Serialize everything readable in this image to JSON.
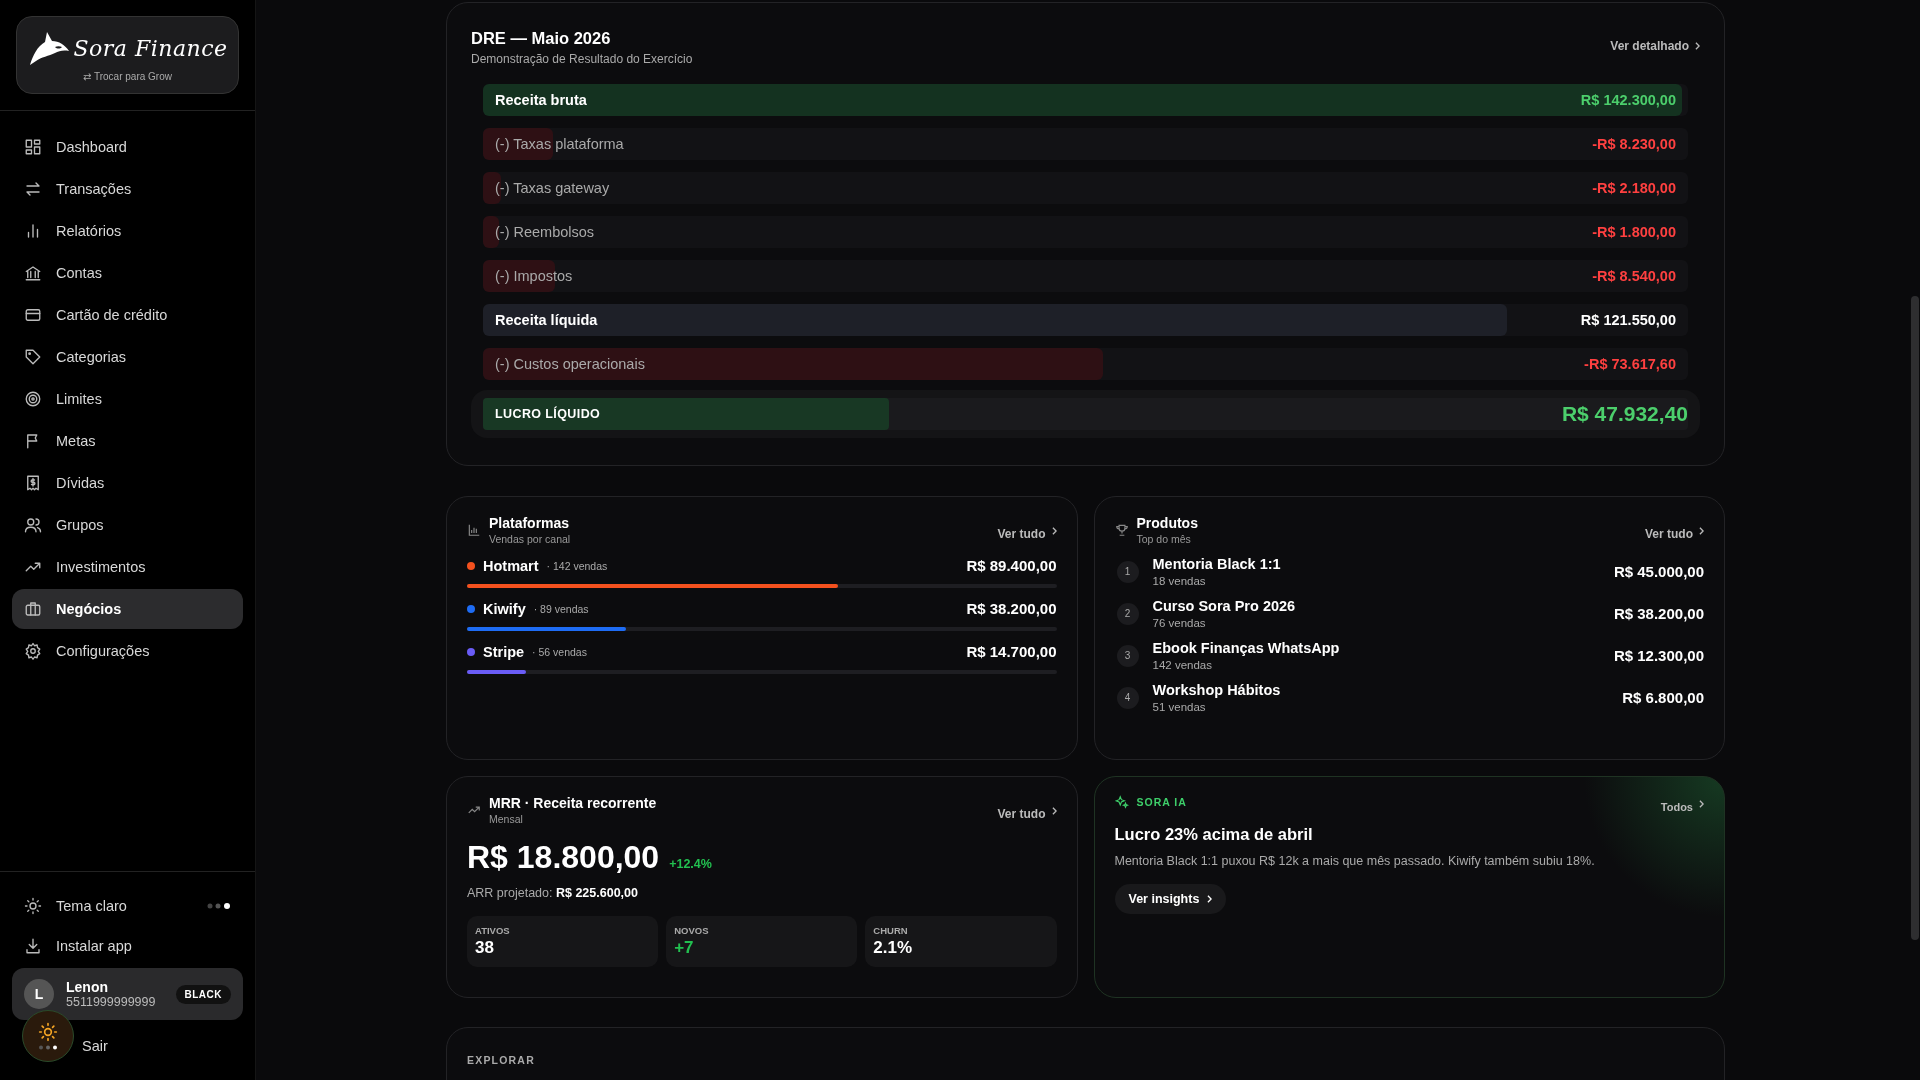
{
  "sidebar": {
    "logo_text": "Sora Finance",
    "switch_label": "⇄ Trocar para Grow",
    "nav": [
      {
        "label": "Dashboard",
        "selected": false
      },
      {
        "label": "Transações",
        "selected": false
      },
      {
        "label": "Relatórios",
        "selected": false
      },
      {
        "label": "Contas",
        "selected": false
      },
      {
        "label": "Cartão de crédito",
        "selected": false
      },
      {
        "label": "Categorias",
        "selected": false
      },
      {
        "label": "Limites",
        "selected": false
      },
      {
        "label": "Metas",
        "selected": false
      },
      {
        "label": "Dívidas",
        "selected": false
      },
      {
        "label": "Grupos",
        "selected": false
      },
      {
        "label": "Investimentos",
        "selected": false
      },
      {
        "label": "Negócios",
        "selected": true
      },
      {
        "label": "Configurações",
        "selected": false
      }
    ],
    "theme_label": "Tema claro",
    "install_label": "Instalar app",
    "user": {
      "initial": "L",
      "name": "Lenon",
      "phone": "5511999999999",
      "badge": "BLACK"
    },
    "logout_label": "Sair"
  },
  "dre": {
    "title": "DRE — Maio 2026",
    "subtitle": "Demonstração de Resultado do Exercício",
    "link": "Ver detalhado",
    "rows": [
      {
        "kind": "total",
        "label": "Receita bruta",
        "value": "R$ 142.300,00",
        "level": 1
      },
      {
        "kind": "deduction",
        "label": "(-) Taxas plataforma",
        "value": "-R$ 8.230,00",
        "level": 0.058
      },
      {
        "kind": "deduction",
        "label": "(-) Taxas gateway",
        "value": "-R$ 2.180,00",
        "level": 0.015
      },
      {
        "kind": "deduction",
        "label": "(-) Reembolsos",
        "value": "-R$ 1.800,00",
        "level": 0.013
      },
      {
        "kind": "deduction",
        "label": "(-) Impostos",
        "value": "-R$ 8.540,00",
        "level": 0.06
      },
      {
        "kind": "subtotal",
        "label": "Receita líquida",
        "value": "R$ 121.550,00",
        "level": 0.854
      },
      {
        "kind": "deduction",
        "label": "(-) Custos operacionais",
        "value": "-R$ 73.617,60",
        "level": 0.517
      }
    ],
    "result": {
      "label": "LUCRO LÍQUIDO",
      "value": "R$ 47.932,40",
      "level": 0.337
    }
  },
  "platforms": {
    "title": "Plataformas",
    "subtitle": "Vendas por canal",
    "link": "Ver tudo",
    "items": [
      {
        "name": "Hotmart",
        "count": "· 142 vendas",
        "value": "R$ 89.400,00",
        "level": 0.63,
        "color": "#f4511e"
      },
      {
        "name": "Kiwify",
        "count": "· 89 vendas",
        "value": "R$ 38.200,00",
        "level": 0.27,
        "color": "#1e6cf4"
      },
      {
        "name": "Stripe",
        "count": "· 56 vendas",
        "value": "R$ 14.700,00",
        "level": 0.1,
        "color": "#6a5cf6"
      }
    ]
  },
  "products": {
    "title": "Produtos",
    "subtitle": "Top do mês",
    "link": "Ver tudo",
    "items": [
      {
        "rank": "1",
        "name": "Mentoria Black 1:1",
        "sales": "18 vendas",
        "value": "R$ 45.000,00"
      },
      {
        "rank": "2",
        "name": "Curso Sora Pro 2026",
        "sales": "76 vendas",
        "value": "R$ 38.200,00"
      },
      {
        "rank": "3",
        "name": "Ebook Finanças WhatsApp",
        "sales": "142 vendas",
        "value": "R$ 12.300,00"
      },
      {
        "rank": "4",
        "name": "Workshop Hábitos",
        "sales": "51 vendas",
        "value": "R$ 6.800,00"
      }
    ]
  },
  "mrr": {
    "title": "MRR · Receita recorrente",
    "subtitle": "Mensal",
    "link": "Ver tudo",
    "value": "R$ 18.800,00",
    "change": "+12.4%",
    "arr_label": "ARR projetado:",
    "arr_value": "R$ 225.600,00",
    "stats": [
      {
        "label": "ATIVOS",
        "value": "38",
        "kind": "neutral"
      },
      {
        "label": "NOVOS",
        "value": "+7",
        "kind": "positive"
      },
      {
        "label": "CHURN",
        "value": "2.1%",
        "kind": "neutral"
      }
    ]
  },
  "ai": {
    "tag": "SORA IA",
    "link": "Todos",
    "title": "Lucro 23% acima de abril",
    "text": "Mentoria Black 1:1 puxou R$ 12k a mais que mês passado. Kiwify também subiu 18%.",
    "button": "Ver insights"
  },
  "explore": {
    "title": "EXPLORAR"
  }
}
